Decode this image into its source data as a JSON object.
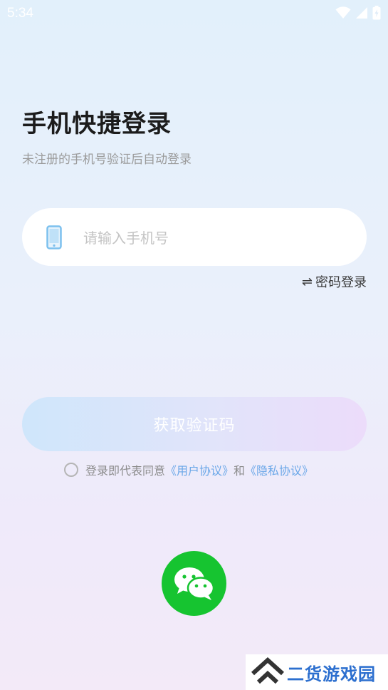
{
  "status_bar": {
    "time": "5:34",
    "icons": [
      "wifi-icon",
      "signal-icon",
      "battery-icon"
    ]
  },
  "header": {
    "title": "手机快捷登录",
    "subtitle": "未注册的手机号验证后自动登录"
  },
  "phone_field": {
    "icon": "phone-icon",
    "value": "",
    "placeholder": "请输入手机号"
  },
  "password_login": {
    "icon": "swap-icon",
    "symbol": "⇌",
    "label": "密码登录"
  },
  "get_code_button": {
    "label": "获取验证码"
  },
  "agreement": {
    "checked": false,
    "prefix": "登录即代表同意",
    "user_agreement": "《用户协议》",
    "and": "和",
    "privacy_agreement": "《隐私协议》"
  },
  "social_login": {
    "icon": "wechat-icon"
  },
  "watermark": {
    "text": "二货游戏园"
  },
  "colors": {
    "accent_link": "#6aa7e8",
    "wechat_green": "#16c430",
    "title": "#1c1c1c",
    "subtitle": "#9b9b9b",
    "watermark_blue": "#2c6fcf"
  }
}
